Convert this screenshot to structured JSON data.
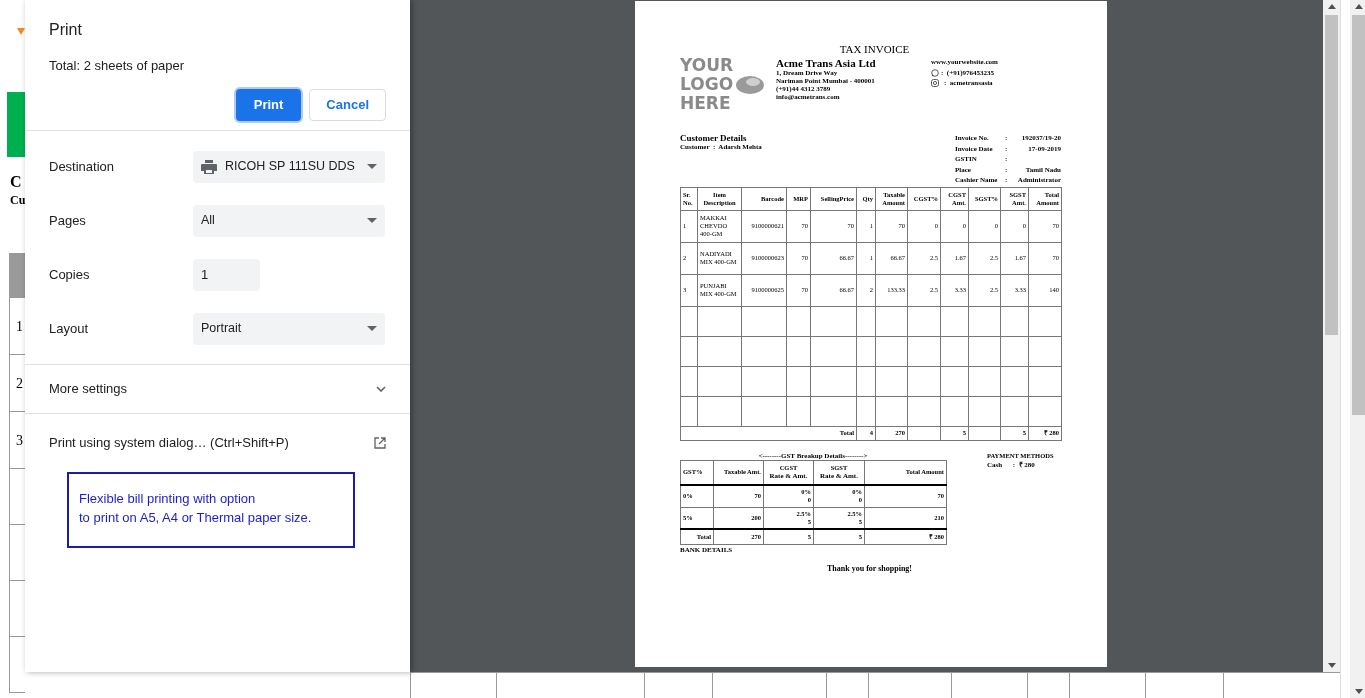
{
  "background": {
    "heading_fragments": [
      "C",
      "Cu"
    ],
    "row_numbers": [
      "1",
      "2",
      "3"
    ]
  },
  "print_dialog": {
    "title": "Print",
    "summary": "Total: 2 sheets of paper",
    "buttons": [
      {
        "label": "Print",
        "kind": "primary"
      },
      {
        "label": "Cancel",
        "kind": "secondary"
      }
    ],
    "settings": [
      {
        "label": "Destination",
        "kind": "select",
        "value": "RICOH SP 111SU DDS"
      },
      {
        "label": "Pages",
        "kind": "select",
        "value": "All"
      },
      {
        "label": "Copies",
        "kind": "input",
        "value": "1"
      },
      {
        "label": "Layout",
        "kind": "select",
        "value": "Portrait"
      }
    ],
    "more_settings": {
      "label": "More settings",
      "expanded": false
    },
    "system_dialog": "Print using system dialog… (Ctrl+Shift+P)",
    "note": [
      "Flexible bill printing with option",
      "to print on A5, A4 or Thermal paper size."
    ]
  },
  "invoice": {
    "title": "TAX INVOICE",
    "logo": [
      "YOUR",
      "LOGO",
      "HERE"
    ],
    "company": {
      "name": "Acme Trans Asia Ltd",
      "lines": [
        "1, Dream Drive Way",
        "Nariman Point Mumbai - 400001",
        "(+91)44 4312 3789",
        "info@acmetrans.com"
      ]
    },
    "website": "www.yourwebsite.com",
    "contacts": [
      {
        "kind": "whatsapp",
        "separator": ":",
        "value": "(+91)976453235"
      },
      {
        "kind": "instagram",
        "separator": ":",
        "value": "acmetransasia"
      }
    ],
    "customer_heading": "Customer Details",
    "customer": {
      "label": "Customer",
      "separator": ":",
      "value": "Adarsh Mehta"
    },
    "details": [
      {
        "label": "Invoice No.",
        "separator": ":",
        "value": "192037/19-20"
      },
      {
        "label": "Invoice Date",
        "separator": ":",
        "value": "17-09-2019"
      },
      {
        "label": "GSTIN",
        "separator": ":"
      },
      {
        "label": "Place",
        "separator": ":",
        "value": "Tamil Nadu"
      },
      {
        "label": "Cashier Name",
        "separator": ":",
        "value": "Administrator"
      }
    ],
    "items": {
      "columns": [
        "Sr. No.",
        "Item Description",
        "Barcode",
        "MRP",
        "SellingPrice",
        "Qty",
        "Taxable Amount",
        "CGST%",
        "CGST Amt.",
        "SGST%",
        "SGST Amt.",
        "Total Amount"
      ],
      "rows": [
        [
          "1",
          "MAKKAI CHEVDO 400-GM",
          "9100000621",
          "70",
          "70",
          "1",
          "70",
          "0",
          "0",
          "0",
          "0",
          "70"
        ],
        [
          "2",
          "NADIYADI MIX 400-GM",
          "9100000623",
          "70",
          "66.67",
          "1",
          "66.67",
          "2.5",
          "1.67",
          "2.5",
          "1.67",
          "70"
        ],
        [
          "3",
          "PUNJABI MIX 400-GM",
          "9100000625",
          "70",
          "66.67",
          "2",
          "133.33",
          "2.5",
          "3.33",
          "2.5",
          "3.33",
          "140"
        ]
      ],
      "total": {
        "label": "Total",
        "qty": "4",
        "taxable": "270",
        "cgst": "5",
        "sgst": "5",
        "amount": "₹ 280"
      }
    },
    "gst_breakup": {
      "title": "<--------GST Breakup Details-------->",
      "columns": [
        {
          "label": "GST%"
        },
        {
          "label": "Taxable Amt."
        },
        {
          "label": "CGST",
          "sub": "Rate & Amt."
        },
        {
          "label": "SGST",
          "sub": "Rate & Amt."
        },
        {
          "label": "Total Amount"
        }
      ],
      "rows": [
        {
          "gst": "0%",
          "taxable": "70",
          "cgst_rate": "0%",
          "cgst_amt": "0",
          "sgst_rate": "0%",
          "sgst_amt": "0",
          "total": "70"
        },
        {
          "gst": "5%",
          "taxable": "200",
          "cgst_rate": "2.5%",
          "cgst_amt": "5",
          "sgst_rate": "2.5%",
          "sgst_amt": "5",
          "total": "210"
        }
      ],
      "total": {
        "label": "Total",
        "taxable": "270",
        "cgst": "5",
        "sgst": "5",
        "total": "₹ 280"
      }
    },
    "payment": {
      "heading": "PAYMENT METHODS",
      "label": "Cash",
      "separator": ":",
      "value": "₹ 280"
    },
    "bank_heading": "BANK DETAILS",
    "thanks": "Thank you for shopping!"
  }
}
